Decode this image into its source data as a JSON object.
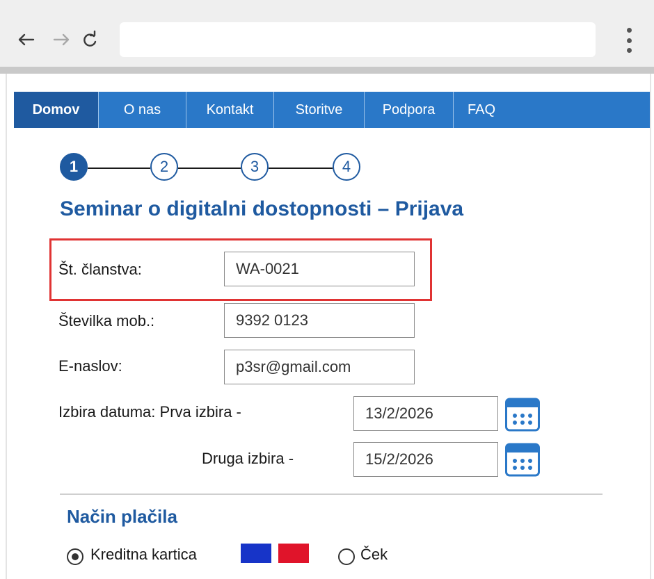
{
  "browser": {
    "address_value": ""
  },
  "nav": {
    "tabs": [
      "Domov",
      "O nas",
      "Kontakt",
      "Storitve",
      "Podpora",
      "FAQ"
    ],
    "active_tab": "Domov"
  },
  "steps": {
    "items": [
      "1",
      "2",
      "3",
      "4"
    ],
    "active": "1"
  },
  "form": {
    "title": "Seminar o digitalni dostopnosti – Prijava",
    "membership": {
      "label": "Št. članstva:",
      "value": "WA-0021"
    },
    "mobile": {
      "label": "Številka mob.:",
      "value": "9392 0123"
    },
    "email": {
      "label": "E-naslov:",
      "value": "p3sr@gmail.com"
    },
    "date": {
      "label": "Izbira datuma: Prva izbira -",
      "first_value": "13/2/2026",
      "second_label": "Druga izbira -",
      "second_value": "15/2/2026"
    }
  },
  "payment": {
    "title": "Način plačila",
    "options": [
      "Kreditna kartica",
      "Ček"
    ],
    "selected": "Kreditna kartica",
    "card_colors": [
      "#1734c8",
      "#e0142a"
    ]
  },
  "colors": {
    "accent": "#1f5aa0",
    "nav_bg": "#2a78c8",
    "highlight": "#e03333"
  }
}
